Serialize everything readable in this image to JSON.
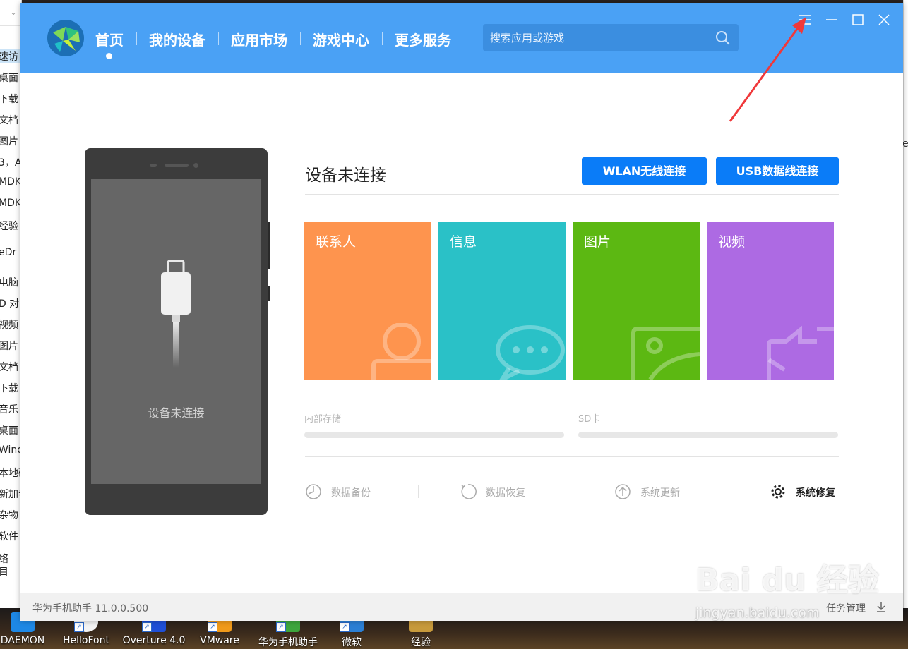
{
  "explorer_sidebar": {
    "items": [
      "速访",
      "桌面",
      "下载",
      "文档",
      "图片",
      "3，A",
      "MDK",
      "MDK",
      "经验",
      "eDr",
      "电脑",
      "D 对",
      "视频",
      "图片",
      "文档",
      "下载",
      "音乐",
      "桌面",
      "Wind",
      "本地磁",
      "新加卷",
      "杂物 (",
      "软件 (",
      "络",
      "目"
    ]
  },
  "app": {
    "nav": {
      "items": [
        "首页",
        "我的设备",
        "应用市场",
        "游戏中心",
        "更多服务"
      ],
      "active_index": 0
    },
    "search": {
      "placeholder": "搜索应用或游戏"
    },
    "phone": {
      "status": "设备未连接"
    },
    "status_title": "设备未连接",
    "buttons": {
      "wlan": "WLAN无线连接",
      "usb": "USB数据线连接"
    },
    "tiles": [
      {
        "label": "联系人",
        "color": "#fe944e",
        "icon": "contact-icon"
      },
      {
        "label": "信息",
        "color": "#2ac1c7",
        "icon": "message-icon"
      },
      {
        "label": "图片",
        "color": "#5cb812",
        "icon": "picture-icon"
      },
      {
        "label": "视频",
        "color": "#ad6ae3",
        "icon": "video-icon"
      }
    ],
    "storage": {
      "internal": "内部存储",
      "sd": "SD卡"
    },
    "tools": [
      {
        "label": "数据备份",
        "icon": "backup-icon",
        "enabled": false
      },
      {
        "label": "数据恢复",
        "icon": "restore-icon",
        "enabled": false
      },
      {
        "label": "系统更新",
        "icon": "update-icon",
        "enabled": false
      },
      {
        "label": "系统修复",
        "icon": "repair-icon",
        "enabled": true
      }
    ],
    "footer": {
      "version": "华为手机助手 11.0.0.500",
      "task_manager": "任务管理"
    },
    "colors": {
      "header": "#4aa1f5",
      "button": "#0a7cf8"
    }
  },
  "taskbar": {
    "items": [
      "DAEMON",
      "HelloFont",
      "Overture 4.0",
      "VMware",
      "华为手机助手",
      "微软",
      "经验"
    ]
  },
  "watermark": {
    "text": "Bai du 经验",
    "url": "jingyan.baidu.com"
  }
}
